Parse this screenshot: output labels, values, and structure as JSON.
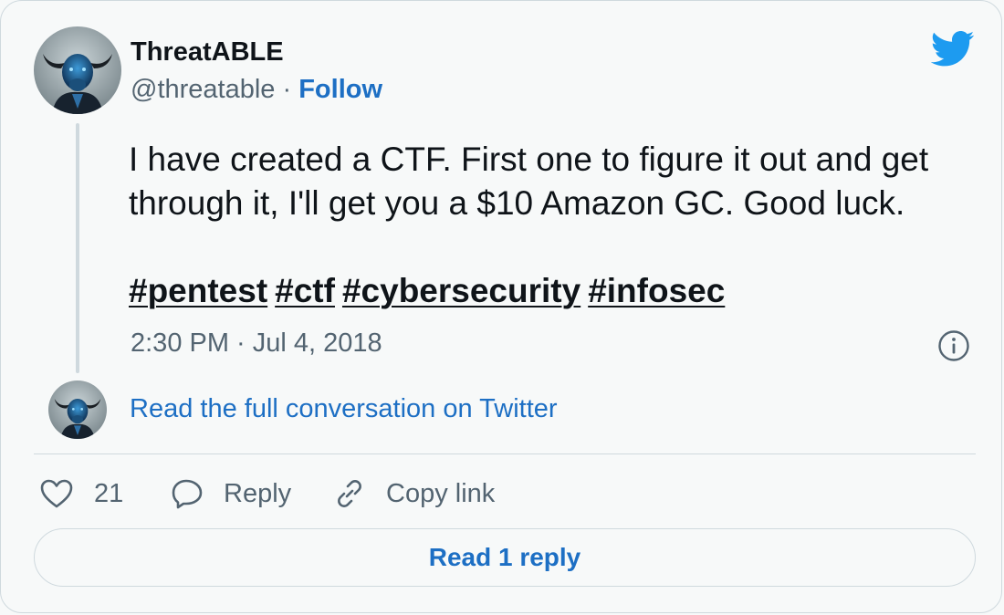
{
  "author": {
    "name": "ThreatABLE",
    "handle": "@threatable",
    "separator": " · ",
    "follow_label": "Follow",
    "avatar_icon": "bull-avatar"
  },
  "platform_icon": "twitter-bird-icon",
  "tweet": {
    "text": "I have created a CTF. First one to figure it out and get through it, I'll get you a $10 Amazon GC. Good luck.",
    "hashtags": [
      "#pentest",
      "#ctf",
      "#cybersecurity",
      "#infosec"
    ],
    "timestamp": "2:30 PM · Jul 4, 2018"
  },
  "conversation": {
    "link_text": "Read the full conversation on Twitter"
  },
  "actions": {
    "like_count": "21",
    "reply_label": "Reply",
    "copy_link_label": "Copy link"
  },
  "read_replies_label": "Read 1 reply",
  "colors": {
    "link": "#1d6fc4",
    "text": "#0f1419",
    "muted": "#536471",
    "twitter_blue": "#1d9bf0",
    "border": "#cfd9de",
    "background": "#f7f9f9"
  }
}
